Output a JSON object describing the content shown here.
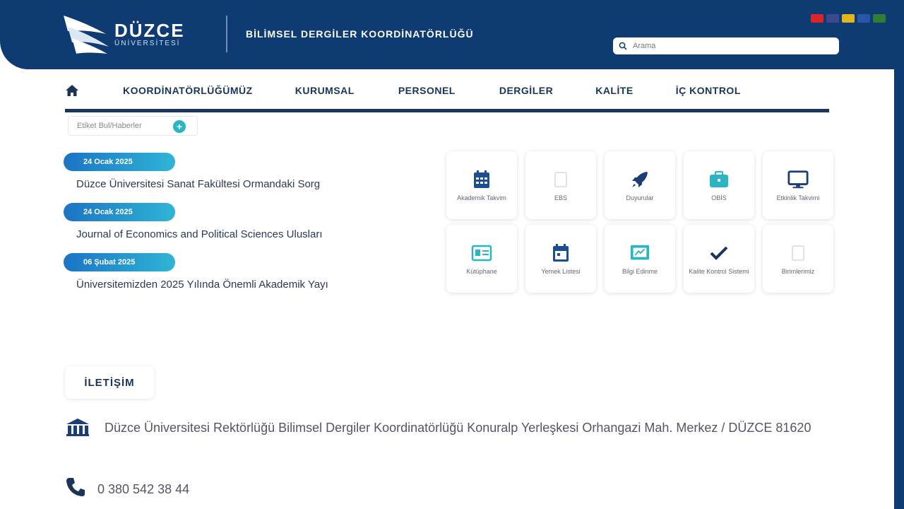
{
  "header": {
    "logo_title": "DÜZCE",
    "logo_subtitle": "ÜNİVERSİTESİ",
    "unit_title": "BİLİMSEL DERGİLER KOORDİNATÖRLÜĞÜ",
    "search_placeholder": "Arama",
    "languages": [
      {
        "code": "tr",
        "color": "#d9262b"
      },
      {
        "code": "en",
        "color": "#3b4a8f"
      },
      {
        "code": "de",
        "color": "#e0b51e"
      },
      {
        "code": "fr",
        "color": "#2a56a6"
      },
      {
        "code": "ar",
        "color": "#2e7d32"
      }
    ]
  },
  "nav": {
    "items": [
      {
        "label": "KOORDİNATÖRLÜĞÜMÜZ"
      },
      {
        "label": "KURUMSAL"
      },
      {
        "label": "PERSONEL"
      },
      {
        "label": "DERGİLER"
      },
      {
        "label": "KALİTE"
      },
      {
        "label": "İÇ KONTROL"
      }
    ]
  },
  "tag_toggle": {
    "label": "Etiket Bul/Haberler",
    "plus": "+"
  },
  "news": [
    {
      "date": "24 Ocak 2025",
      "title": "Düzce Üniversitesi Sanat Fakültesi Ormandaki Sorg"
    },
    {
      "date": "24 Ocak 2025",
      "title": "Journal of Economics and Political Sciences Ulusları"
    },
    {
      "date": "06 Şubat 2025",
      "title": "Üniversitemizden 2025 Yılında Önemli Akademik Yayı"
    }
  ],
  "quick_links": [
    {
      "label": "Akademik Takvim",
      "icon": "calendar-grid-icon",
      "color": "#1b4f8f"
    },
    {
      "label": "EBS",
      "icon": "blank-icon",
      "color": "#c9d2dd"
    },
    {
      "label": "Duyurular",
      "icon": "rocket-icon",
      "color": "#1b3f74"
    },
    {
      "label": "OBİS",
      "icon": "briefcase-icon",
      "color": "#2ab5c4"
    },
    {
      "label": "Etkinlik Takvimi",
      "icon": "monitor-icon",
      "color": "#1b3f74"
    },
    {
      "label": "Kütüphane",
      "icon": "id-card-icon",
      "color": "#2ab5c4"
    },
    {
      "label": "Yemek Listesi",
      "icon": "calendar-icon",
      "color": "#1b4f8f"
    },
    {
      "label": "Bilgi Edinme",
      "icon": "presentation-icon",
      "color": "#2ab5c4"
    },
    {
      "label": "Kalite Kontrol Sistemi",
      "icon": "check-icon",
      "color": "#1b3459"
    },
    {
      "label": "Birimlerimiz",
      "icon": "blank-icon",
      "color": "#c9d2dd"
    }
  ],
  "contact": {
    "heading": "İLETİŞİM",
    "address": "Düzce Üniversitesi Rektörlüğü Bilimsel Dergiler Koordinatörlüğü Konuralp Yerleşkesi Orhangazi Mah. Merkez / DÜZCE 81620",
    "phone": "0 380 542 38 44"
  }
}
